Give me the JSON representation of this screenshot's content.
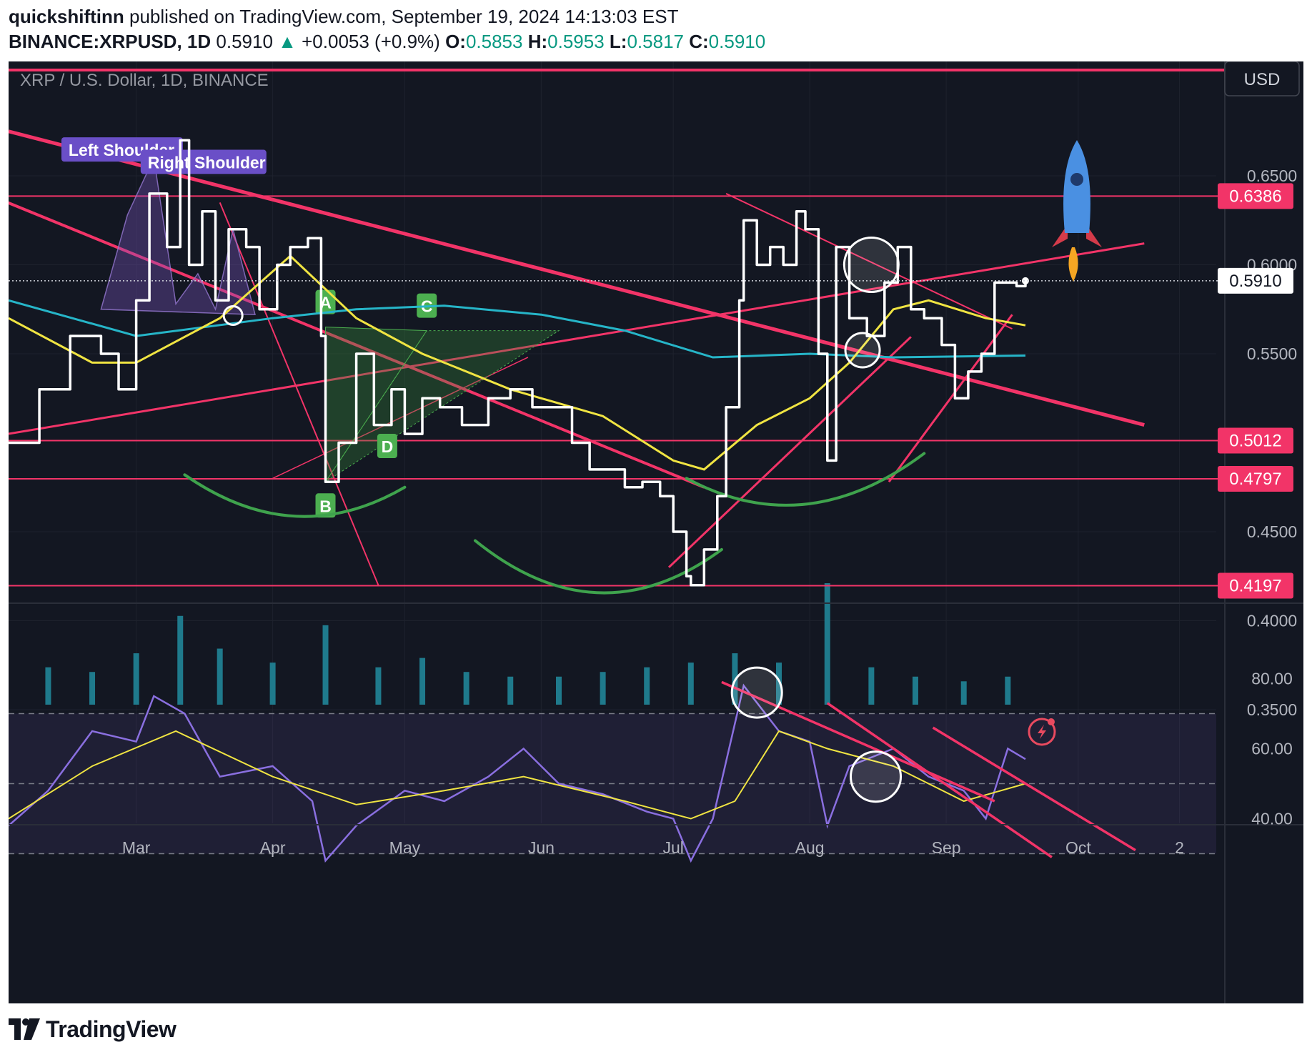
{
  "header": {
    "publisher": "quickshiftinn",
    "published_text": "published on TradingView.com, September 19, 2024 14:13:03 EST",
    "symbol": "BINANCE:XRPUSD, 1D",
    "last": "0.5910",
    "change": "+0.0053 (+0.9%)",
    "o_label": "O:",
    "o": "0.5853",
    "h_label": "H:",
    "h": "0.5953",
    "l_label": "L:",
    "l": "0.5817",
    "c_label": "C:",
    "c": "0.5910"
  },
  "legend": {
    "title": "XRP / U.S. Dollar, 1D, BINANCE"
  },
  "currency_button": "USD",
  "footer": {
    "brand": "TradingView"
  },
  "colors": {
    "background": "#131722",
    "price": "#ffffff",
    "ma_fast": "#f0e442",
    "ma_slow": "#26b5c8",
    "levels": "#f23468",
    "arcs": "#3fa34d",
    "rsi": "#8a6fe0",
    "rsi_ma": "#f0e442",
    "volume": "#1f7a8c"
  },
  "chart_data": [
    {
      "type": "line",
      "title": "XRP / U.S. Dollar, 1D, BINANCE",
      "ylim": [
        0.34,
        0.69
      ],
      "y_ticks": [
        "0.6500",
        "0.6000",
        "0.5500",
        "0.4500",
        "0.4000",
        "0.3500"
      ],
      "x_ticks": [
        "Mar",
        "Apr",
        "May",
        "Jun",
        "Jul",
        "Aug",
        "Sep",
        "Oct",
        "2"
      ],
      "horizontal_levels": [
        {
          "label": "0.6386",
          "value": 0.6386
        },
        {
          "label": "0.5012",
          "value": 0.5012
        },
        {
          "label": "0.4797",
          "value": 0.4797
        },
        {
          "label": "0.4197",
          "value": 0.4197
        }
      ],
      "last_price_label": "0.5910",
      "last_price": 0.591,
      "pattern_labels": [
        "Left Shoulder",
        "Right Shoulder",
        "A",
        "B",
        "C",
        "D"
      ],
      "series": [
        {
          "name": "XRPUSD",
          "x": [
            "2024-02-01",
            "2024-02-08",
            "2024-02-15",
            "2024-02-22",
            "2024-02-26",
            "2024-03-01",
            "2024-03-04",
            "2024-03-08",
            "2024-03-11",
            "2024-03-13",
            "2024-03-16",
            "2024-03-19",
            "2024-03-22",
            "2024-03-26",
            "2024-03-29",
            "2024-04-02",
            "2024-04-05",
            "2024-04-09",
            "2024-04-12",
            "2024-04-13",
            "2024-04-16",
            "2024-04-20",
            "2024-04-24",
            "2024-04-28",
            "2024-05-01",
            "2024-05-05",
            "2024-05-09",
            "2024-05-14",
            "2024-05-20",
            "2024-05-25",
            "2024-05-30",
            "2024-06-04",
            "2024-06-08",
            "2024-06-12",
            "2024-06-16",
            "2024-06-20",
            "2024-06-24",
            "2024-06-28",
            "2024-07-01",
            "2024-07-04",
            "2024-07-05",
            "2024-07-08",
            "2024-07-11",
            "2024-07-13",
            "2024-07-16",
            "2024-07-17",
            "2024-07-20",
            "2024-07-23",
            "2024-07-26",
            "2024-07-29",
            "2024-07-31",
            "2024-08-03",
            "2024-08-05",
            "2024-08-07",
            "2024-08-10",
            "2024-08-14",
            "2024-08-18",
            "2024-08-21",
            "2024-08-24",
            "2024-08-27",
            "2024-08-31",
            "2024-09-03",
            "2024-09-06",
            "2024-09-09",
            "2024-09-12",
            "2024-09-14",
            "2024-09-17",
            "2024-09-19"
          ],
          "values": [
            0.5,
            0.53,
            0.56,
            0.55,
            0.53,
            0.58,
            0.64,
            0.61,
            0.67,
            0.6,
            0.63,
            0.58,
            0.62,
            0.61,
            0.575,
            0.6,
            0.61,
            0.615,
            0.56,
            0.478,
            0.5,
            0.55,
            0.51,
            0.53,
            0.505,
            0.525,
            0.52,
            0.51,
            0.525,
            0.53,
            0.52,
            0.52,
            0.5,
            0.485,
            0.485,
            0.475,
            0.478,
            0.47,
            0.45,
            0.425,
            0.42,
            0.44,
            0.47,
            0.52,
            0.58,
            0.625,
            0.6,
            0.61,
            0.6,
            0.63,
            0.62,
            0.55,
            0.49,
            0.61,
            0.57,
            0.56,
            0.59,
            0.61,
            0.575,
            0.57,
            0.555,
            0.525,
            0.54,
            0.55,
            0.59,
            0.59,
            0.588,
            0.591
          ]
        },
        {
          "name": "",
          "x": [
            "2024-02-01",
            "2024-02-20",
            "2024-03-01",
            "2024-03-20",
            "2024-04-05",
            "2024-04-20",
            "2024-05-05",
            "2024-05-25",
            "2024-06-15",
            "2024-07-01",
            "2024-07-08",
            "2024-07-20",
            "2024-08-01",
            "2024-08-10",
            "2024-08-20",
            "2024-08-28",
            "2024-09-10",
            "2024-09-19"
          ],
          "values": [
            0.57,
            0.545,
            0.545,
            0.57,
            0.605,
            0.57,
            0.55,
            0.53,
            0.515,
            0.49,
            0.485,
            0.51,
            0.525,
            0.545,
            0.575,
            0.58,
            0.57,
            0.566
          ]
        },
        {
          "name": "",
          "x": [
            "2024-02-01",
            "2024-03-01",
            "2024-04-01",
            "2024-04-20",
            "2024-05-10",
            "2024-06-01",
            "2024-06-20",
            "2024-07-10",
            "2024-08-01",
            "2024-08-20",
            "2024-09-19"
          ],
          "values": [
            0.58,
            0.56,
            0.57,
            0.575,
            0.577,
            0.572,
            0.563,
            0.548,
            0.55,
            0.548,
            0.549
          ]
        }
      ]
    },
    {
      "type": "bar",
      "title": "Volume",
      "x": [
        "2024-02-10",
        "2024-02-20",
        "2024-03-01",
        "2024-03-11",
        "2024-03-20",
        "2024-04-01",
        "2024-04-13",
        "2024-04-25",
        "2024-05-05",
        "2024-05-15",
        "2024-05-25",
        "2024-06-05",
        "2024-06-15",
        "2024-06-25",
        "2024-07-05",
        "2024-07-15",
        "2024-07-25",
        "2024-08-05",
        "2024-08-15",
        "2024-08-25",
        "2024-09-05",
        "2024-09-15"
      ],
      "values": [
        40,
        35,
        55,
        95,
        60,
        45,
        85,
        40,
        50,
        35,
        30,
        30,
        35,
        40,
        45,
        55,
        45,
        130,
        40,
        30,
        25,
        30
      ]
    },
    {
      "type": "line",
      "title": "RSI",
      "ylim": [
        25,
        90
      ],
      "y_ticks": [
        "80.00",
        "60.00",
        "40.00"
      ],
      "bands": [
        70,
        50,
        30
      ],
      "series": [
        {
          "name": "",
          "x": [
            "2024-02-01",
            "2024-02-10",
            "2024-02-20",
            "2024-03-01",
            "2024-03-05",
            "2024-03-12",
            "2024-03-20",
            "2024-04-01",
            "2024-04-10",
            "2024-04-13",
            "2024-04-20",
            "2024-05-01",
            "2024-05-10",
            "2024-05-20",
            "2024-05-28",
            "2024-06-05",
            "2024-06-15",
            "2024-06-25",
            "2024-07-01",
            "2024-07-05",
            "2024-07-10",
            "2024-07-17",
            "2024-07-25",
            "2024-08-01",
            "2024-08-05",
            "2024-08-10",
            "2024-08-20",
            "2024-08-28",
            "2024-09-05",
            "2024-09-10",
            "2024-09-15",
            "2024-09-19"
          ],
          "values": [
            38,
            48,
            65,
            62,
            75,
            70,
            52,
            55,
            45,
            28,
            38,
            48,
            45,
            52,
            60,
            50,
            47,
            42,
            40,
            28,
            40,
            78,
            65,
            62,
            38,
            55,
            60,
            52,
            48,
            40,
            60,
            57
          ]
        },
        {
          "name": "",
          "x": [
            "2024-02-01",
            "2024-02-20",
            "2024-03-10",
            "2024-04-01",
            "2024-04-20",
            "2024-05-10",
            "2024-05-28",
            "2024-06-20",
            "2024-07-05",
            "2024-07-15",
            "2024-07-25",
            "2024-08-05",
            "2024-08-20",
            "2024-09-05",
            "2024-09-19"
          ],
          "values": [
            40,
            55,
            65,
            52,
            44,
            48,
            52,
            45,
            40,
            45,
            65,
            60,
            55,
            45,
            50
          ]
        }
      ]
    }
  ]
}
